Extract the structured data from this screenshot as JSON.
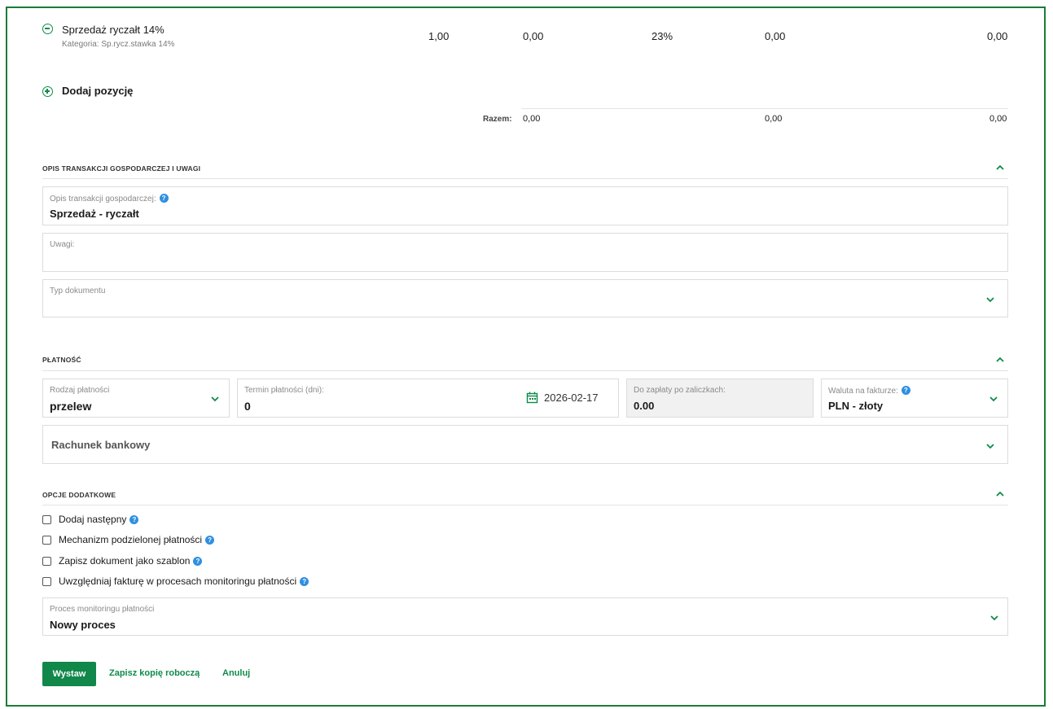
{
  "item": {
    "name": "Sprzedaż ryczałt 14%",
    "category": "Kategoria: Sp.rycz.stawka 14%",
    "quantity": "1,00",
    "net_price": "0,00",
    "vat_rate": "23%",
    "vat_amount": "0,00",
    "gross": "0,00"
  },
  "add_position_label": "Dodaj pozycję",
  "totals": {
    "label": "Razem:",
    "net": "0,00",
    "vat": "0,00",
    "gross": "0,00"
  },
  "section_description": {
    "title": "OPIS TRANSAKCJI GOSPODARCZEJ I UWAGI",
    "transaction_label": "Opis transakcji gospodarczej:",
    "transaction_value": "Sprzedaż - ryczałt",
    "remarks_label": "Uwagi:",
    "remarks_value": "",
    "doc_type_label": "Typ dokumentu",
    "doc_type_value": ""
  },
  "section_payment": {
    "title": "PŁATNOŚĆ",
    "method_label": "Rodzaj płatności",
    "method_value": "przelew",
    "term_label": "Termin płatności (dni):",
    "term_value": "0",
    "due_date": "2026-02-17",
    "to_pay_label": "Do zapłaty po zaliczkach:",
    "to_pay_value": "0.00",
    "currency_label": "Waluta na fakturze:",
    "currency_value": "PLN - złoty",
    "bank_account_label": "Rachunek bankowy"
  },
  "section_options": {
    "title": "OPCJE DODATKOWE",
    "checkboxes": [
      {
        "label": "Dodaj następny",
        "checked": false
      },
      {
        "label": "Mechanizm podzielonej płatności",
        "checked": false
      },
      {
        "label": "Zapisz dokument jako szablon",
        "checked": false
      },
      {
        "label": "Uwzględniaj fakturę w procesach monitoringu płatności",
        "checked": false
      }
    ],
    "monitoring_label": "Proces monitoringu płatności",
    "monitoring_value": "Nowy proces"
  },
  "actions": {
    "issue": "Wystaw",
    "save_draft": "Zapisz kopię roboczą",
    "cancel": "Anuluj"
  },
  "colors": {
    "accent": "#0f8a4b",
    "frame": "#1c7a3a",
    "help": "#2f8fe0"
  }
}
